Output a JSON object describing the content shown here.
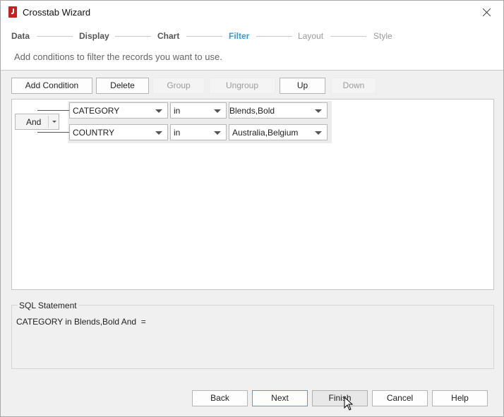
{
  "window": {
    "title": "Crosstab Wizard"
  },
  "steps": [
    {
      "label": "Data",
      "state": "done"
    },
    {
      "label": "Display",
      "state": "done"
    },
    {
      "label": "Chart",
      "state": "done"
    },
    {
      "label": "Filter",
      "state": "active"
    },
    {
      "label": "Layout",
      "state": "future"
    },
    {
      "label": "Style",
      "state": "future"
    }
  ],
  "subtitle": "Add conditions to filter the records you want to use.",
  "toolbar": {
    "add_condition": "Add Condition",
    "delete": "Delete",
    "group": "Group",
    "ungroup": "Ungroup",
    "up": "Up",
    "down": "Down"
  },
  "conditions": {
    "logic": "And",
    "rows": [
      {
        "field": "CATEGORY",
        "operator": "in",
        "value": "Blends,Bold"
      },
      {
        "field": "COUNTRY",
        "operator": "in",
        "value": "Australia,Belgium"
      }
    ]
  },
  "sql": {
    "legend": "SQL Statement",
    "statement": "CATEGORY in Blends,Bold And  ="
  },
  "footer": {
    "back": "Back",
    "next": "Next",
    "finish": "Finish",
    "cancel": "Cancel",
    "help": "Help"
  },
  "colors": {
    "active_step": "#3a9ad9",
    "default_button_border": "#5a9bd6",
    "app_icon": "#c8201f"
  },
  "icons": [
    "app-logo-icon",
    "close-icon",
    "dropdown-arrow-icon",
    "mouse-pointer-icon"
  ]
}
